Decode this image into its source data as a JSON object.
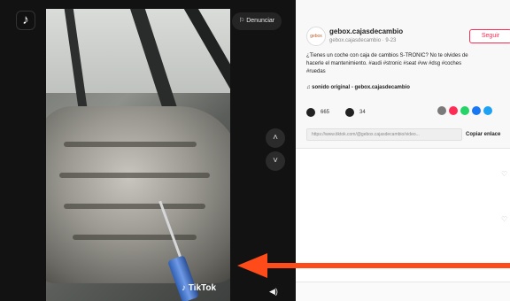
{
  "video": {
    "report_label": "Denunciar",
    "watermark": "TikTok",
    "nav_up": "˄",
    "nav_down": "˅"
  },
  "side": {
    "avatar_text": "gebox",
    "username": "gebox.cajasdecambio",
    "subname": "gebox.cajasdecambio · 9-23",
    "follow_label": "Seguir",
    "desc_line1": "¿Tienes un coche con caja de cambios S-TRONIC? No te olvides de",
    "desc_line2": "hacerle el mantenimiento. #audi #stronic #seat #vw #dsg #coches",
    "desc_line3": "#ruedas",
    "sound": "♫  sonido original - gebox.cajasdecambio",
    "likes": "665",
    "comments": "34",
    "link": "https://www.tiktok.com/@gebox.cajasdecambio/video...",
    "copy_label": "Copiar enlace"
  },
  "colors": {
    "accent": "#fe2c55",
    "arrow": "#ff4b1a",
    "share": [
      "#7a7a7a",
      "#fe2c55",
      "#25d366",
      "#1877f2",
      "#1da1f2"
    ]
  }
}
